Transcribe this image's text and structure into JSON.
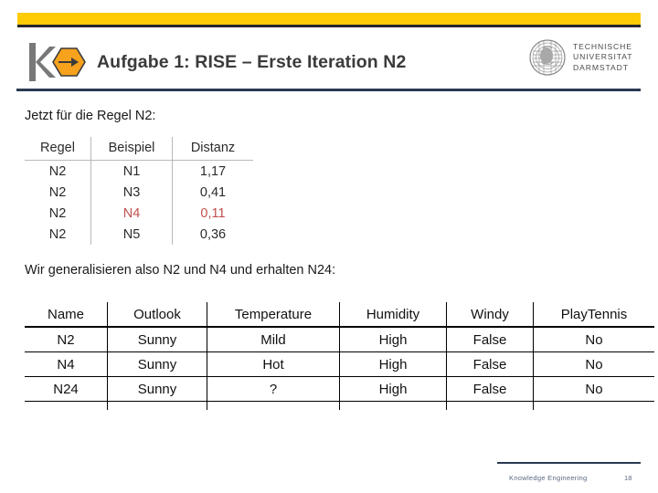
{
  "header": {
    "title": "Aufgabe 1: RISE – Erste Iteration N2",
    "ke_logo_name": "knowledge-engineering-logo",
    "university": {
      "line1": "TECHNISCHE",
      "line2": "UNIVERSITAT",
      "line3": "DARMSTADT"
    },
    "colors": {
      "accent_yellow": "#ffcb05",
      "dark_rule": "#26262b",
      "navy_rule": "#2b3a52",
      "title_text": "#3b3b3b"
    }
  },
  "body": {
    "paragraph_1": "Jetzt für die Regel N2:",
    "paragraph_2": "Wir generalisieren also N2 und N4 und erhalten N24:"
  },
  "table_distance": {
    "headers": [
      "Regel",
      "Beispiel",
      "Distanz"
    ],
    "rows": [
      {
        "regel": "N2",
        "beispiel": "N1",
        "distanz": "1,17",
        "highlighted": false
      },
      {
        "regel": "N2",
        "beispiel": "N3",
        "distanz": "0,41",
        "highlighted": false
      },
      {
        "regel": "N2",
        "beispiel": "N4",
        "distanz": "0,11",
        "highlighted": true
      },
      {
        "regel": "N2",
        "beispiel": "N5",
        "distanz": "0,36",
        "highlighted": false
      }
    ],
    "highlight_color": "#c0504d"
  },
  "table_examples": {
    "headers": [
      "Name",
      "Outlook",
      "Temperature",
      "Humidity",
      "Windy",
      "PlayTennis"
    ],
    "rows": [
      {
        "name": "N2",
        "outlook": "Sunny",
        "temperature": "Mild",
        "humidity": "High",
        "windy": "False",
        "playtennis": "No"
      },
      {
        "name": "N4",
        "outlook": "Sunny",
        "temperature": "Hot",
        "humidity": "High",
        "windy": "False",
        "playtennis": "No"
      },
      {
        "name": "N24",
        "outlook": "Sunny",
        "temperature": "?",
        "humidity": "High",
        "windy": "False",
        "playtennis": "No"
      }
    ]
  },
  "footer": {
    "label": "Knowledge Engineering",
    "page_number": "18"
  }
}
